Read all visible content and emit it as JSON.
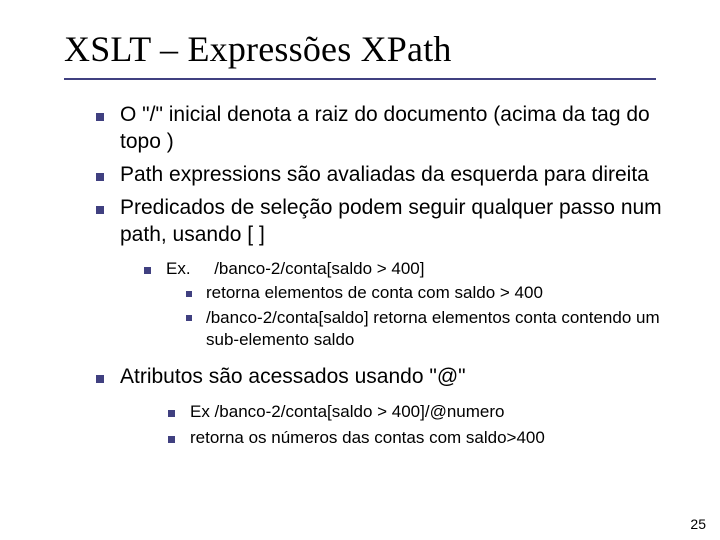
{
  "title": "XSLT – Expressões XPath",
  "bullets": {
    "b1": "O \"/\" inicial denota a raiz do documento (acima da tag do topo )",
    "b2": "Path expressions são avaliadas da esquerda para direita",
    "b3": "Predicados de seleção podem seguir qualquer passo num path, usando [ ]",
    "b3_sub": {
      "ex_label": "Ex.",
      "ex_path": "/banco-2/conta[saldo > 400]",
      "s1": "retorna elementos de conta com saldo > 400",
      "s2": "/banco-2/conta[saldo]  retorna elementos conta contendo um sub-elemento saldo"
    },
    "b4": "Atributos são acessados usando \"@\"",
    "b4_sub": {
      "s1": "Ex  /banco-2/conta[saldo > 400]/@numero",
      "s2": "retorna os números das contas com saldo>400"
    }
  },
  "page_number": "25"
}
